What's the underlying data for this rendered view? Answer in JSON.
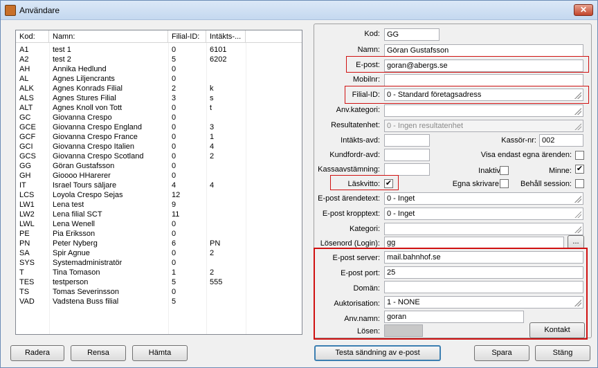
{
  "window": {
    "title": "Användare",
    "close_icon": "close-icon",
    "app_icon": "app-icon"
  },
  "list": {
    "columns": [
      "Kod:",
      "Namn:",
      "Filial-ID:",
      "Intäkts-..."
    ],
    "rows": [
      [
        "A1",
        "test 1",
        "0",
        "6101"
      ],
      [
        "A2",
        "test 2",
        "5",
        "6202"
      ],
      [
        "AH",
        "Annika Hedlund",
        "0",
        ""
      ],
      [
        "AL",
        "Agnes Liljencrants",
        "0",
        ""
      ],
      [
        "ALK",
        "Agnes Konrads Filial",
        "2",
        "k"
      ],
      [
        "ALS",
        "Agnes Stures Filial",
        "3",
        "s"
      ],
      [
        "ALT",
        "Agnes Knoll von Tott",
        "0",
        "t"
      ],
      [
        "GC",
        "Giovanna Crespo",
        "0",
        ""
      ],
      [
        "GCE",
        "Giovanna Crespo England",
        "0",
        "3"
      ],
      [
        "GCF",
        "Giovanna Crespo  France",
        "0",
        "1"
      ],
      [
        "GCI",
        "Giovanna Crespo Italien",
        "0",
        "4"
      ],
      [
        "GCS",
        "Giovanna Crespo Scotland",
        "0",
        "2"
      ],
      [
        "GG",
        "Göran Gustafsson",
        "0",
        ""
      ],
      [
        "GH",
        "Gioooo HHarerer",
        "0",
        ""
      ],
      [
        "IT",
        "Israel Tours säljare",
        "4",
        "4"
      ],
      [
        "LCS",
        "Loyola Crespo Sejas",
        "12",
        ""
      ],
      [
        "LW1",
        "Lena test",
        "9",
        ""
      ],
      [
        "LW2",
        "Lena filial SCT",
        "11",
        ""
      ],
      [
        "LWL",
        "Lena Wenell",
        "0",
        ""
      ],
      [
        "PE",
        "Pia Eriksson",
        "0",
        ""
      ],
      [
        "PN",
        "Peter Nyberg",
        "6",
        "PN"
      ],
      [
        "SA",
        "Spir Agnue",
        "0",
        "2"
      ],
      [
        "SYS",
        "Systemadministratör",
        "0",
        ""
      ],
      [
        "T",
        "Tina Tomason",
        "1",
        "2"
      ],
      [
        "TES",
        "testperson",
        "5",
        "555"
      ],
      [
        "TS",
        "Tomas Severinsson",
        "0",
        ""
      ],
      [
        "VAD",
        "Vadstena Buss filial",
        "5",
        ""
      ]
    ]
  },
  "form": {
    "kod": {
      "label": "Kod:",
      "value": "GG"
    },
    "namn": {
      "label": "Namn:",
      "value": "Göran Gustafsson"
    },
    "epost": {
      "label": "E-post:",
      "value": "goran@abergs.se"
    },
    "mobilnr": {
      "label": "Mobilnr:",
      "value": ""
    },
    "filialid": {
      "label": "Filial-ID:",
      "value": "0      - Standard företagsadress"
    },
    "anvkategori": {
      "label": "Anv.kategori:",
      "value": ""
    },
    "resultatenhet": {
      "label": "Resultatenhet:",
      "value": "0      - Ingen resultatenhet"
    },
    "intaktsavd": {
      "label": "Intäkts-avd:",
      "value": ""
    },
    "kassornr": {
      "label": "Kassör-nr:",
      "value": "002"
    },
    "kundfordravd": {
      "label": "Kundfordr-avd:",
      "value": ""
    },
    "visaendast": {
      "label": "Visa endast egna ärenden:",
      "checked": false
    },
    "kassaavstamning": {
      "label": "Kassaavstämning:",
      "value": ""
    },
    "inaktiv": {
      "label": "Inaktiv:",
      "checked": false
    },
    "minne": {
      "label": "Minne:",
      "checked": true
    },
    "laskvitto": {
      "label": "Läskvitto:",
      "checked": true
    },
    "egnaskrivare": {
      "label": "Egna skrivare:",
      "checked": false
    },
    "behallsession": {
      "label": "Behåll session:",
      "checked": false
    },
    "eposttext": {
      "label": "E-post ärendetext:",
      "value": "0      - Inget"
    },
    "epostkropp": {
      "label": "E-post kropptext:",
      "value": "0      - Inget"
    },
    "kategori": {
      "label": "Kategori:",
      "value": ""
    },
    "losenord": {
      "label": "Lösenord (Login):",
      "value": "gg",
      "browse": "..."
    },
    "epostserver": {
      "label": "E-post server:",
      "value": "mail.bahnhof.se"
    },
    "epostport": {
      "label": "E-post port:",
      "value": "25"
    },
    "doman": {
      "label": "Domän:",
      "value": ""
    },
    "auktorisation": {
      "label": "Auktorisation:",
      "value": "1   - NONE"
    },
    "anvnamn": {
      "label": "Anv.namn:",
      "value": "goran"
    },
    "losen": {
      "label": "Lösen:",
      "value": ""
    },
    "kontakt": "Kontakt"
  },
  "buttons": {
    "radera": "Radera",
    "rensa": "Rensa",
    "hamta": "Hämta",
    "testa": "Testa sändning av e-post",
    "spara": "Spara",
    "stang": "Stäng"
  },
  "colors": {
    "highlight": "#d01010",
    "check": "✔"
  }
}
